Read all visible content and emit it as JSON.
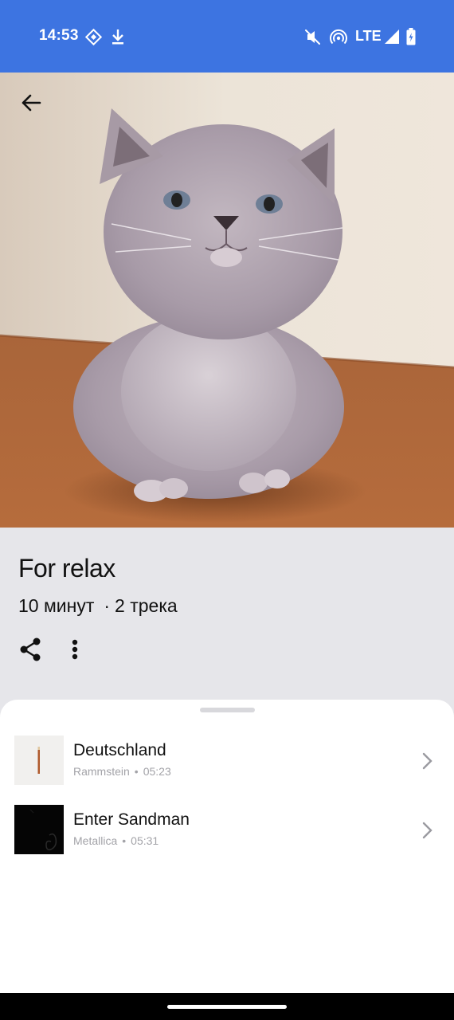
{
  "status_bar": {
    "time": "14:53",
    "network": "LTE",
    "icons": [
      "nfc-diamond-icon",
      "download-icon",
      "mute-vibrate-icon",
      "hotspot-icon",
      "signal-icon",
      "battery-charging-icon"
    ]
  },
  "colors": {
    "status_bar_bg": "#3d74e1",
    "header_bg": "#e6e6ea",
    "sheet_bg": "#ffffff",
    "subtitle_gray": "#a3a3a8"
  },
  "playlist": {
    "title": "For relax",
    "duration": "10 минут",
    "track_count": "2 трека",
    "meta_separator": "·"
  },
  "tracks": [
    {
      "title": "Deutschland",
      "artist": "Rammstein",
      "duration": "05:23",
      "separator": "•"
    },
    {
      "title": "Enter Sandman",
      "artist": "Metallica",
      "duration": "05:31",
      "separator": "•"
    }
  ]
}
